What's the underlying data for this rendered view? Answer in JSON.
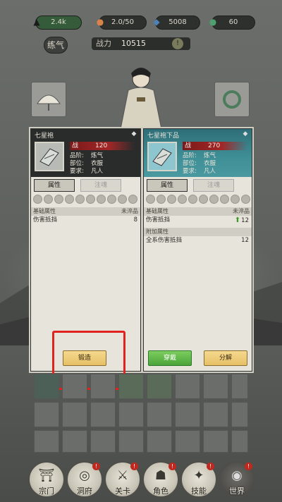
{
  "topbar": {
    "stats": [
      {
        "icon": "realm-icon",
        "value": "2.4k"
      },
      {
        "icon": "peach-icon",
        "value": "2.0/50"
      },
      {
        "icon": "gem-icon",
        "value": "5008"
      },
      {
        "icon": "jade-icon",
        "value": "60"
      }
    ]
  },
  "header": {
    "qi_label": "练气",
    "power_label": "战力",
    "power_value": "10515",
    "info_symbol": "!"
  },
  "left_panel": {
    "title": "七星袍",
    "power_label": "战",
    "power_value": "120",
    "attrs": [
      {
        "k": "品阶:",
        "v": "炼气"
      },
      {
        "k": "部位:",
        "v": "衣服"
      },
      {
        "k": "要求:",
        "v": "凡人"
      }
    ],
    "tab_active": "属性",
    "tab_inactive": "注魂",
    "section_base": "基础属性",
    "section_base_right": "未淬品",
    "rows": [
      {
        "label": "伤害抵挡",
        "value": "8"
      }
    ],
    "button_forge": "锻造"
  },
  "right_panel": {
    "title": "七星袍下品",
    "power_label": "战",
    "power_value": "270",
    "attrs": [
      {
        "k": "品阶:",
        "v": "炼气"
      },
      {
        "k": "部位:",
        "v": "衣服"
      },
      {
        "k": "要求:",
        "v": "凡人"
      }
    ],
    "tab_active": "属性",
    "tab_inactive": "注魂",
    "section_base": "基础属性",
    "section_base_right": "未淬品",
    "rows": [
      {
        "label": "伤害抵挡",
        "value": "12"
      }
    ],
    "section_extra": "附加属性",
    "extra_rows": [
      {
        "label": "全系伤害抵挡",
        "value": "12"
      }
    ],
    "button_wear": "穿戴",
    "button_decompose": "分解"
  },
  "nav": {
    "items": [
      {
        "label": "宗门",
        "icon": "pagoda-icon",
        "badge": ""
      },
      {
        "label": "洞府",
        "icon": "cave-icon",
        "badge": "!"
      },
      {
        "label": "关卡",
        "icon": "sword-icon",
        "badge": "!"
      },
      {
        "label": "角色",
        "icon": "character-icon",
        "badge": "!"
      },
      {
        "label": "技能",
        "icon": "skill-icon",
        "badge": "!"
      },
      {
        "label": "世界",
        "icon": "world-icon",
        "badge": "!"
      }
    ]
  },
  "colors": {
    "highlight": "#e0231f",
    "power_tag": "#a32626",
    "wear_button": "#4ca43a",
    "forge_button": "#e6c066",
    "right_header": "#3f8f97"
  }
}
